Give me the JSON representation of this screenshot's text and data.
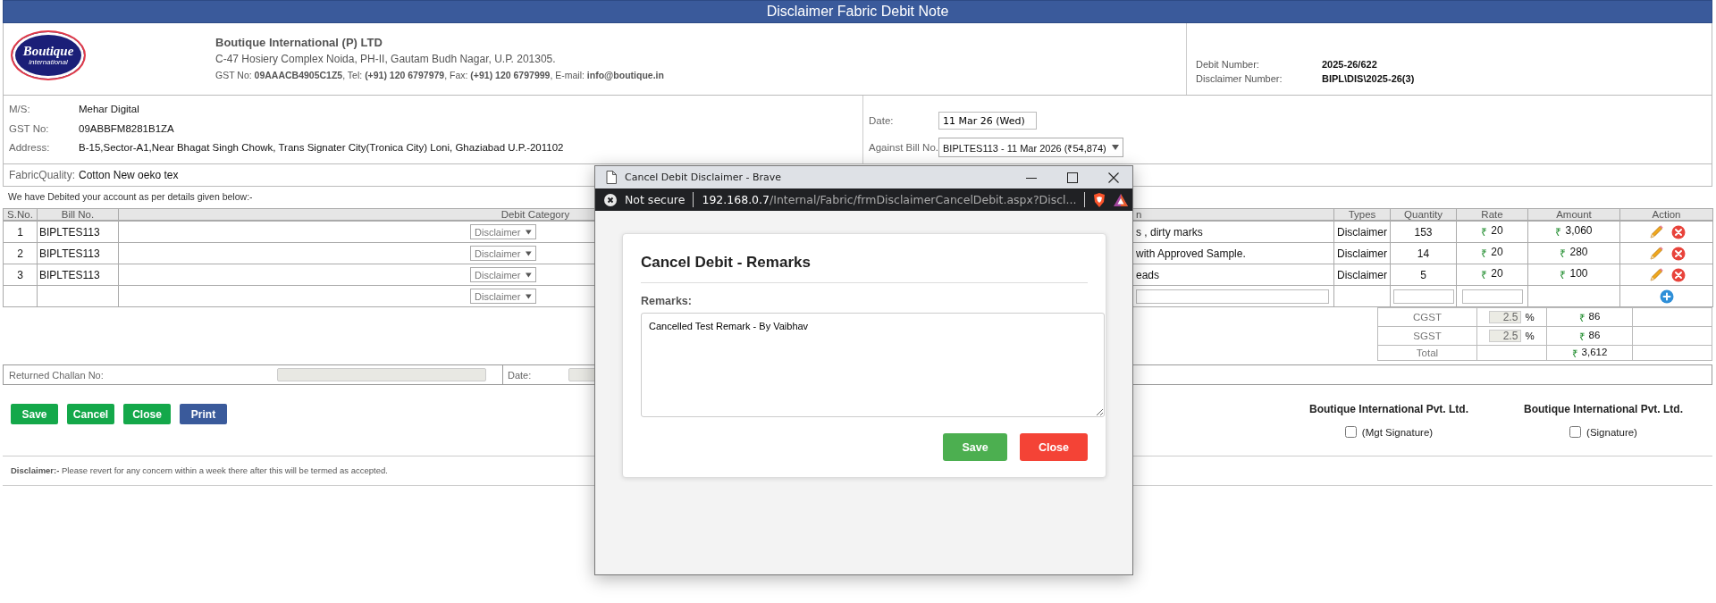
{
  "title": "Disclaimer Fabric Debit Note",
  "company": {
    "logo": {
      "wordmark": "Boutique",
      "tagline": "international"
    },
    "name": "Boutique International (P) LTD",
    "address": "C-47 Hosiery Complex Noida, PH-II, Gautam Budh Nagar, U.P. 201305.",
    "contact": "GST No: **09AAACB4905C1Z5**, Tel: **(+91) 120 6797979**, Fax: **(+91) 120 6797999**, E-mail: **info@boutique.in**"
  },
  "numbers": [
    {
      "label": "Debit Number:",
      "value": "2025-26/622"
    },
    {
      "label": "Disclaimer Number:",
      "value": "BIPL\\DIS\\2025-26(3)"
    }
  ],
  "party": [
    {
      "label": "M/S:",
      "value": "Mehar Digital"
    },
    {
      "label": "GST No:",
      "value": "09ABBFM8281B1ZA"
    },
    {
      "label": "Address:",
      "value": "B-15,Sector-A1,Near Bhagat Singh Chowk, Trans Signater City(Tronica City) Loni, Ghaziabad U.P.-201102"
    }
  ],
  "date": {
    "label": "Date:",
    "value": "11 Mar 26 (Wed)"
  },
  "against_bill": {
    "label": "Against Bill No.",
    "value": "BIPLTES113 - 11 Mar 2026 (₹54,874)"
  },
  "fabric_quality": {
    "label": "FabricQuality:",
    "value": "Cotton New oeko tex"
  },
  "intro": "We have Debited your account as per details given below:-",
  "table": {
    "columns": [
      "S.No.",
      "Bill No.",
      "Debit Category",
      "n",
      "Types",
      "Quantity",
      "Rate",
      "Amount",
      "Action"
    ],
    "rows": [
      {
        "sno": "1",
        "bill": "BIPLTES113",
        "category": "Disclaimer",
        "description": "s , dirty marks",
        "type": "Disclaimer",
        "quantity": "153",
        "rate": {
          "symbol": "₹",
          "value": "20"
        },
        "amount": {
          "symbol": "₹",
          "value": "3,060"
        }
      },
      {
        "sno": "2",
        "bill": "BIPLTES113",
        "category": "Disclaimer",
        "description": "with Approved Sample.",
        "type": "Disclaimer",
        "quantity": "14",
        "rate": {
          "symbol": "₹",
          "value": "20"
        },
        "amount": {
          "symbol": "₹",
          "value": "280"
        }
      },
      {
        "sno": "3",
        "bill": "BIPLTES113",
        "category": "Disclaimer",
        "description": "eads",
        "type": "Disclaimer",
        "quantity": "5",
        "rate": {
          "symbol": "₹",
          "value": "20"
        },
        "amount": {
          "symbol": "₹",
          "value": "100"
        }
      }
    ],
    "new_row": {
      "category": "Disclaimer"
    }
  },
  "taxes": [
    {
      "label": "CGST",
      "percent": "2.5",
      "sign": "%",
      "amount": {
        "symbol": "₹",
        "value": "86"
      }
    },
    {
      "label": "SGST",
      "percent": "2.5",
      "sign": "%",
      "amount": {
        "symbol": "₹",
        "value": "86"
      }
    }
  ],
  "total": {
    "label": "Total",
    "amount": {
      "symbol": "₹",
      "value": "3,612"
    }
  },
  "returned_challan": {
    "label": "Returned Challan No:",
    "date_label": "Date:"
  },
  "buttons": [
    {
      "label": "Save",
      "kind": "success"
    },
    {
      "label": "Cancel",
      "kind": "success"
    },
    {
      "label": "Close",
      "kind": "success"
    },
    {
      "label": "Print",
      "kind": "primary"
    }
  ],
  "signatures": [
    {
      "company": "Boutique International Pvt. Ltd.",
      "label": "(Mgt Signature)",
      "checked": false
    },
    {
      "company": "Boutique International Pvt. Ltd.",
      "label": "(Signature)",
      "checked": false
    }
  ],
  "disclaimer": "**Disclaimer:-** Please revert for any concern within a week there after this will be termed as accepted.",
  "popup": {
    "window_title": "Cancel Debit Disclaimer - Brave",
    "security": "Not secure",
    "url_host": "192.168.0.7",
    "url_path": "/Internal/Fabric/frmDisclaimerCancelDebit.aspx?Discl...",
    "heading": "Cancel Debit - Remarks",
    "field_label": "Remarks:",
    "remarks": "Cancelled Test Remark - By Vaibhav",
    "buttons": [
      {
        "label": "Save",
        "kind": "success"
      },
      {
        "label": "Close",
        "kind": "danger"
      }
    ]
  }
}
